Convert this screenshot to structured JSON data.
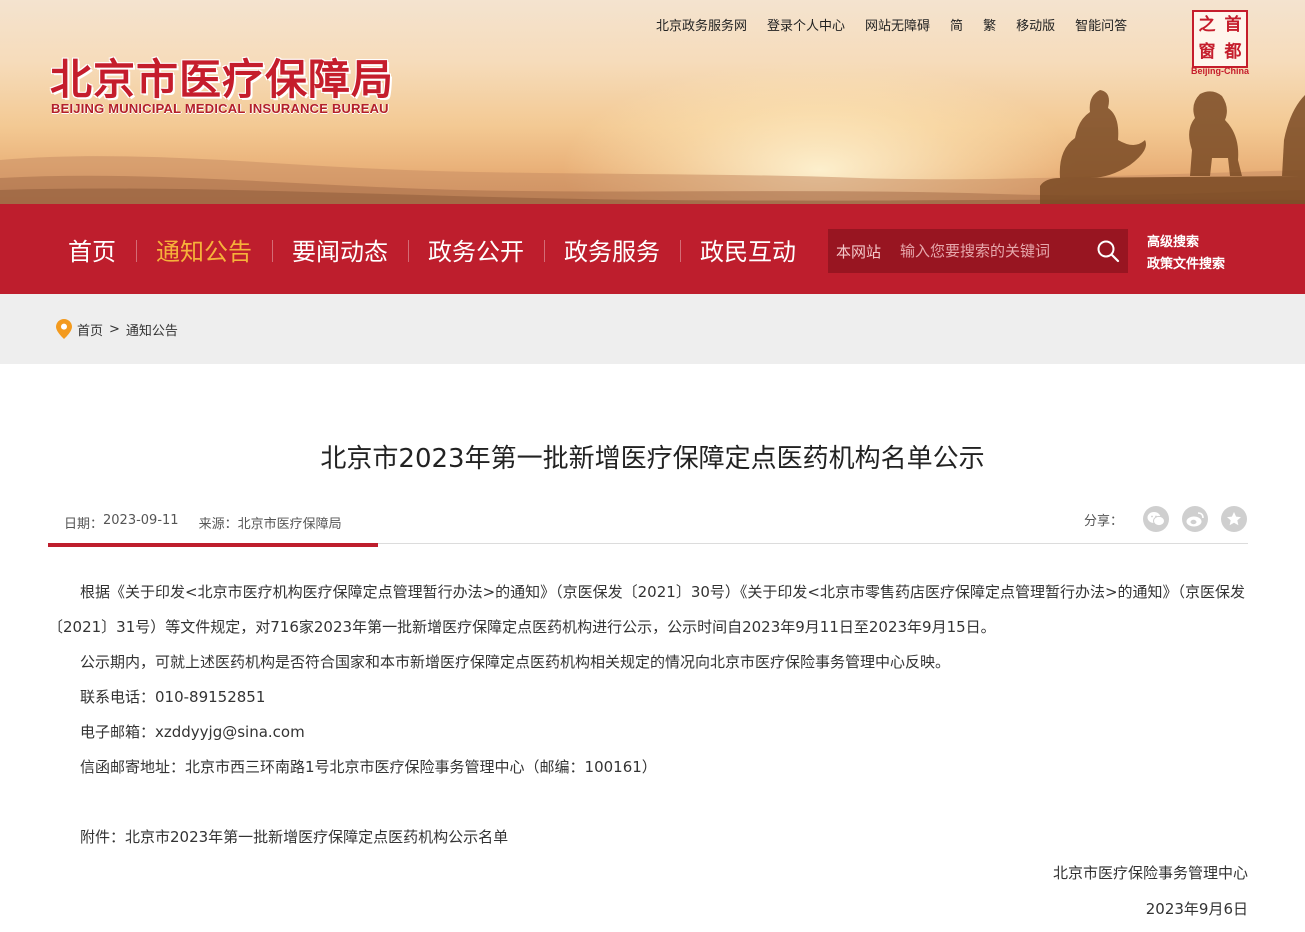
{
  "header": {
    "logo_cn": "北京市医疗保障局",
    "logo_en": "BEIJING MUNICIPAL MEDICAL INSURANCE BUREAU",
    "top_links": [
      "北京政务服务网",
      "登录个人中心",
      "网站无障碍",
      "简",
      "繁",
      "移动版",
      "智能问答"
    ],
    "seal": {
      "chars": [
        "之",
        "首",
        "窗",
        "都"
      ],
      "caption": "Beijing-China"
    }
  },
  "nav": {
    "items": [
      "首页",
      "通知公告",
      "要闻动态",
      "政务公开",
      "政务服务",
      "政民互动"
    ],
    "active_index": 1,
    "search": {
      "scope": "本网站",
      "placeholder": "输入您要搜索的关键词"
    },
    "advanced": [
      "高级搜索",
      "政策文件搜索"
    ]
  },
  "breadcrumb": {
    "home": "首页",
    "separator": ">",
    "current": "通知公告"
  },
  "article": {
    "title": "北京市2023年第一批新增医疗保障定点医药机构名单公示",
    "date_label": "日期：",
    "date": "2023-09-11",
    "source_label": "来源：",
    "source": "北京市医疗保障局",
    "share_label": "分享：",
    "share_icons": [
      "wechat-icon",
      "weibo-icon",
      "favorite-icon"
    ],
    "paragraphs": [
      "根据《关于印发<北京市医疗机构医疗保障定点管理暂行办法>的通知》（京医保发〔2021〕30号）《关于印发<北京市零售药店医疗保障定点管理暂行办法>的通知》（京医保发〔2021〕31号）等文件规定，对716家2023年第一批新增医疗保障定点医药机构进行公示，公示时间自2023年9月11日至2023年9月15日。",
      "公示期内，可就上述医药机构是否符合国家和本市新增医疗保障定点医药机构相关规定的情况向北京市医疗保险事务管理中心反映。",
      "联系电话：010-89152851",
      "电子邮箱：xzddyyjg@sina.com",
      "信函邮寄地址：北京市西三环南路1号北京市医疗保险事务管理中心（邮编：100161）"
    ],
    "attachment": "附件：北京市2023年第一批新增医疗保障定点医药机构公示名单",
    "signature": "北京市医疗保险事务管理中心",
    "sign_date": "2023年9月6日"
  },
  "colors": {
    "brand_red": "#be1e2d",
    "active_nav": "#f6b23a",
    "search_bg": "#981521"
  }
}
